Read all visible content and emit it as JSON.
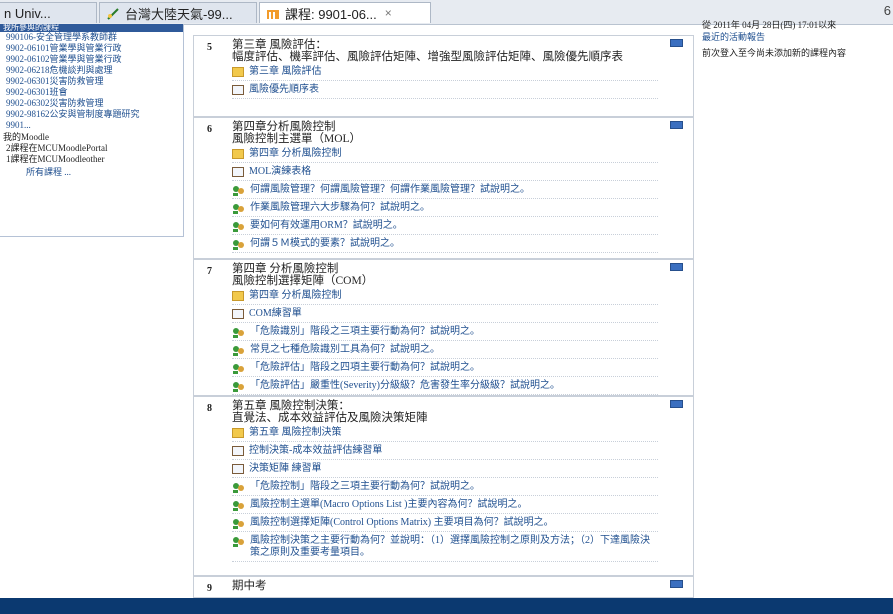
{
  "tabs": [
    {
      "label": "n Univ...",
      "icon": "none"
    },
    {
      "label": "台灣大陸天氣-99...",
      "icon": "leaf-icon"
    },
    {
      "label": "課程: 9901-06...",
      "icon": "moodle-icon",
      "close": "×"
    }
  ],
  "tab_right_glyph": "6",
  "left": {
    "header": "我所參與的課程",
    "courses": [
      "990106-安全管理學系教師群",
      "9902-06101管業學與管業行政",
      "9902-06102管業學與管業行政",
      "9902-06218危機談判與處理",
      "9902-06301災害防救管理",
      "9902-06301班會",
      "9902-06302災害防救管理",
      "9902-98162公安與管制度專題研究",
      "9901..."
    ],
    "moodle_title": "我的Moodle",
    "moodle_items": [
      "2課程在MCUMoodlePortal",
      "1課程在MCUMoodleother"
    ],
    "all_courses": "所有課程 ..."
  },
  "right": {
    "top_text": "從 2011年 04月 28日(四) 17:01以來",
    "link": "最近的活動報告",
    "text": "前次登入至今尚未添加新的課程內容"
  },
  "sections": [
    {
      "num": "5",
      "title": "第三章 風險評估：\n幅度評估、機率評估、風險評估矩陣、增強型風險評估矩陣、風險優先順序表",
      "items": [
        {
          "type": "folder",
          "text": "第三章 風險評估"
        },
        {
          "type": "page",
          "text": "風險優先順序表"
        }
      ]
    },
    {
      "num": "6",
      "title": "第四章分析風險控制\n風險控制主選單（MOL）",
      "items": [
        {
          "type": "folder",
          "text": "第四章 分析風險控制"
        },
        {
          "type": "page",
          "text": "MOL演練表格"
        },
        {
          "type": "forum",
          "text": "何謂風險管理？何謂風險管理？何謂作業風險管理？試說明之。"
        },
        {
          "type": "forum",
          "text": "作業風險管理六大步驟為何？試說明之。"
        },
        {
          "type": "forum",
          "text": "要如何有效運用ORM？試說明之。"
        },
        {
          "type": "forum",
          "text": "何謂５Ｍ模式的要素？試說明之。"
        }
      ]
    },
    {
      "num": "7",
      "title": "第四章 分析風險控制\n風險控制選擇矩陣（COM）",
      "items": [
        {
          "type": "folder",
          "text": "第四章 分析風險控制"
        },
        {
          "type": "page",
          "text": "COM練習單"
        },
        {
          "type": "forum",
          "text": "「危險識別」階段之三項主要行動為何？試說明之。"
        },
        {
          "type": "forum",
          "text": "常見之七種危險識別工具為何？試說明之。"
        },
        {
          "type": "forum",
          "text": "「危險評估」階段之四項主要行動為何？試說明之。"
        },
        {
          "type": "forum",
          "text": "「危險評估」嚴重性(Severity)分級級？危害發生率分級級？試說明之。"
        }
      ]
    },
    {
      "num": "8",
      "title": "第五章 風險控制決策：\n直覺法、成本效益評估及風險決策矩陣",
      "items": [
        {
          "type": "folder",
          "text": "第五章 風險控制決策"
        },
        {
          "type": "page",
          "text": "控制決策-成本效益評估練習單"
        },
        {
          "type": "page",
          "text": "決策矩陣 練習單"
        },
        {
          "type": "forum",
          "text": "「危險控制」階段之三項主要行動為何？試說明之。"
        },
        {
          "type": "forum",
          "text": "風險控制主選單(Macro Options List )主要內容為何？試說明之。"
        },
        {
          "type": "forum",
          "text": "風險控制選擇矩陣(Control Options Matrix) 主要項目為何？試說明之。"
        },
        {
          "type": "forum",
          "text": "風險控制決策之主要行動為何？並說明：（1）選擇風險控制之原則及方法；（2）下達風險決策之原則及重要考量項目。"
        }
      ]
    },
    {
      "num": "9",
      "title": "期中考",
      "items": []
    }
  ],
  "colors": {
    "accent": "#2f5a9a",
    "link": "#1f4f8f",
    "bottom_bar": "#0b3970"
  }
}
